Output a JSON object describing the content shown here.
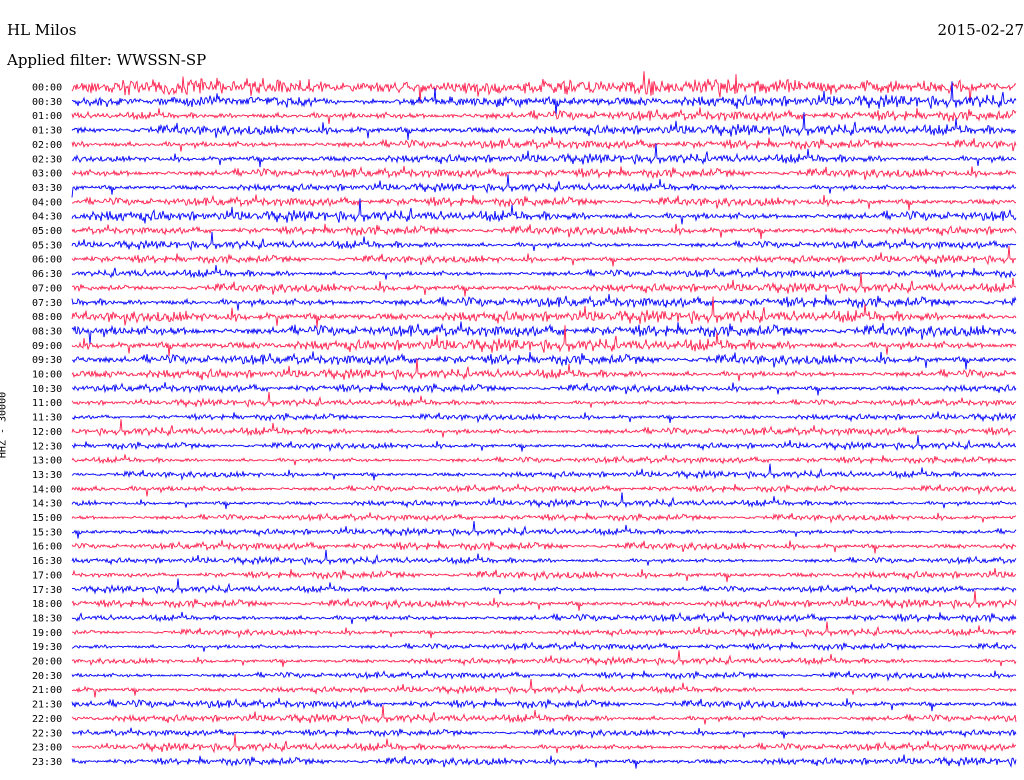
{
  "header": {
    "station": "HL Milos",
    "filter": "Applied filter: WWSSN-SP",
    "date": "2015-02-27"
  },
  "ylabel": "HHZ - 30000",
  "colors": {
    "blue": "#0000ff",
    "red": "#ff1f4d",
    "background": "#ffffff"
  },
  "chart_data": {
    "type": "line",
    "title": "HL Milos",
    "xlabel": "",
    "ylabel": "HHZ - 30000",
    "series_colors": [
      "#0000ff",
      "#ff1f4d"
    ],
    "rows": [
      {
        "label": "00:00",
        "color": "#ff1f4d",
        "activity": 9
      },
      {
        "label": "00:30",
        "color": "#0000ff",
        "activity": 7
      },
      {
        "label": "01:00",
        "color": "#ff1f4d",
        "activity": 6
      },
      {
        "label": "01:30",
        "color": "#0000ff",
        "activity": 6
      },
      {
        "label": "02:00",
        "color": "#ff1f4d",
        "activity": 5
      },
      {
        "label": "02:30",
        "color": "#0000ff",
        "activity": 5
      },
      {
        "label": "03:00",
        "color": "#ff1f4d",
        "activity": 5
      },
      {
        "label": "03:30",
        "color": "#0000ff",
        "activity": 4
      },
      {
        "label": "04:00",
        "color": "#ff1f4d",
        "activity": 5
      },
      {
        "label": "04:30",
        "color": "#0000ff",
        "activity": 6
      },
      {
        "label": "05:00",
        "color": "#ff1f4d",
        "activity": 5
      },
      {
        "label": "05:30",
        "color": "#0000ff",
        "activity": 4
      },
      {
        "label": "06:00",
        "color": "#ff1f4d",
        "activity": 4
      },
      {
        "label": "06:30",
        "color": "#0000ff",
        "activity": 4
      },
      {
        "label": "07:00",
        "color": "#ff1f4d",
        "activity": 5
      },
      {
        "label": "07:30",
        "color": "#0000ff",
        "activity": 6
      },
      {
        "label": "08:00",
        "color": "#ff1f4d",
        "activity": 7
      },
      {
        "label": "08:30",
        "color": "#0000ff",
        "activity": 7
      },
      {
        "label": "09:00",
        "color": "#ff1f4d",
        "activity": 7
      },
      {
        "label": "09:30",
        "color": "#0000ff",
        "activity": 6
      },
      {
        "label": "10:00",
        "color": "#ff1f4d",
        "activity": 5
      },
      {
        "label": "10:30",
        "color": "#0000ff",
        "activity": 4
      },
      {
        "label": "11:00",
        "color": "#ff1f4d",
        "activity": 3
      },
      {
        "label": "11:30",
        "color": "#0000ff",
        "activity": 3
      },
      {
        "label": "12:00",
        "color": "#ff1f4d",
        "activity": 4
      },
      {
        "label": "12:30",
        "color": "#0000ff",
        "activity": 3
      },
      {
        "label": "13:00",
        "color": "#ff1f4d",
        "activity": 3
      },
      {
        "label": "13:30",
        "color": "#0000ff",
        "activity": 3
      },
      {
        "label": "14:00",
        "color": "#ff1f4d",
        "activity": 3
      },
      {
        "label": "14:30",
        "color": "#0000ff",
        "activity": 3
      },
      {
        "label": "15:00",
        "color": "#ff1f4d",
        "activity": 3
      },
      {
        "label": "15:30",
        "color": "#0000ff",
        "activity": 3
      },
      {
        "label": "16:00",
        "color": "#ff1f4d",
        "activity": 4
      },
      {
        "label": "16:30",
        "color": "#0000ff",
        "activity": 3
      },
      {
        "label": "17:00",
        "color": "#ff1f4d",
        "activity": 4
      },
      {
        "label": "17:30",
        "color": "#0000ff",
        "activity": 3
      },
      {
        "label": "18:00",
        "color": "#ff1f4d",
        "activity": 4
      },
      {
        "label": "18:30",
        "color": "#0000ff",
        "activity": 4
      },
      {
        "label": "19:00",
        "color": "#ff1f4d",
        "activity": 3
      },
      {
        "label": "19:30",
        "color": "#0000ff",
        "activity": 3
      },
      {
        "label": "20:00",
        "color": "#ff1f4d",
        "activity": 3
      },
      {
        "label": "20:30",
        "color": "#0000ff",
        "activity": 3
      },
      {
        "label": "21:00",
        "color": "#ff1f4d",
        "activity": 3
      },
      {
        "label": "21:30",
        "color": "#0000ff",
        "activity": 4
      },
      {
        "label": "22:00",
        "color": "#ff1f4d",
        "activity": 4
      },
      {
        "label": "22:30",
        "color": "#0000ff",
        "activity": 3
      },
      {
        "label": "23:00",
        "color": "#ff1f4d",
        "activity": 4
      },
      {
        "label": "23:30",
        "color": "#0000ff",
        "activity": 4
      }
    ]
  }
}
